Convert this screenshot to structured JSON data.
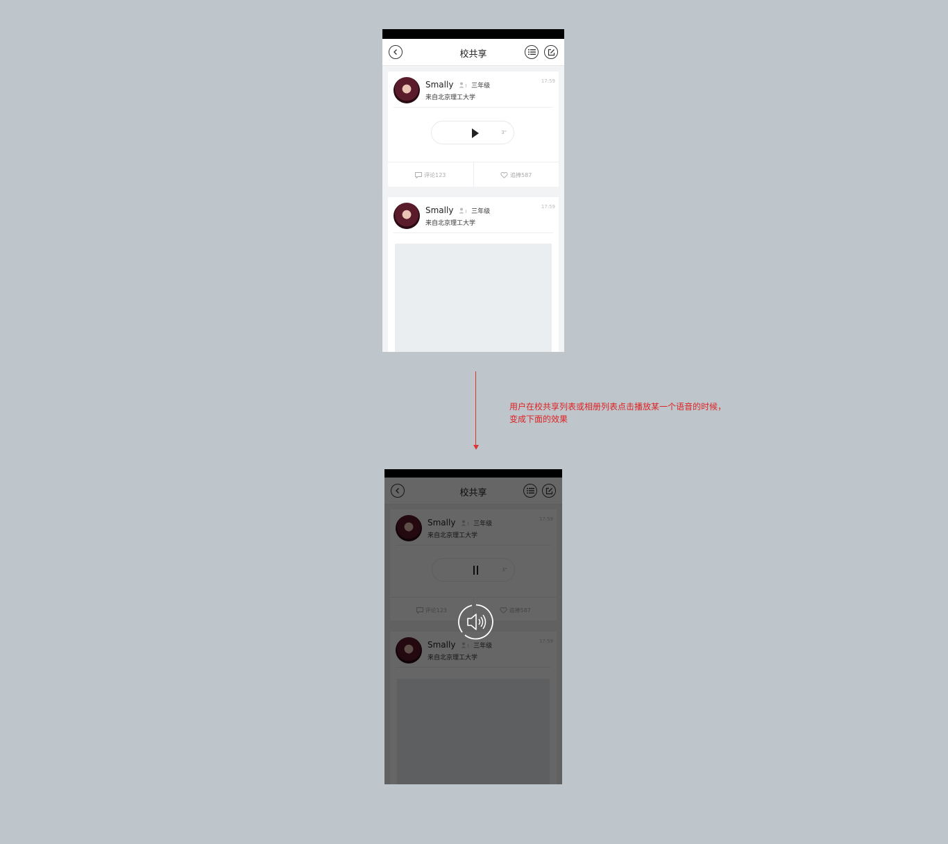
{
  "nav": {
    "title": "校共享"
  },
  "posts": [
    {
      "name": "Smally",
      "grade": "三年级",
      "school": "来自北京理工大学",
      "time": "17:59",
      "duration": "3\"",
      "comment": "评论123",
      "like": "追捧587"
    },
    {
      "name": "Smally",
      "grade": "三年级",
      "school": "来自北京理工大学",
      "time": "17:59"
    }
  ],
  "annotation": {
    "line1": "用户在校共享列表或相册列表点击播放某一个语音的时候，",
    "line2": "变成下面的效果"
  },
  "colors": {
    "background": "#bec6cc",
    "annotation": "#dd2222",
    "overlay": "rgba(0,0,0,0.6)"
  },
  "icons": [
    "back-icon",
    "list-icon",
    "edit-icon",
    "user-icon",
    "play-icon",
    "pause-icon",
    "comment-icon",
    "heart-icon",
    "speaker-icon"
  ]
}
